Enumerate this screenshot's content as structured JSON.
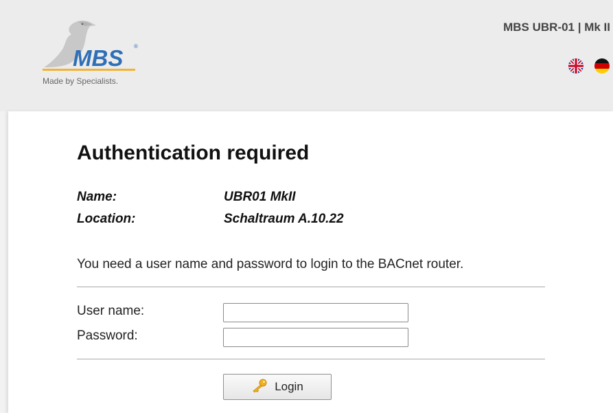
{
  "header": {
    "logo_text": "MBS",
    "logo_tagline": "Made by Specialists.",
    "device_title": "MBS UBR-01 | Mk II",
    "language_flags": [
      {
        "icon": "uk-flag-icon"
      },
      {
        "icon": "german-flag-icon"
      }
    ]
  },
  "main": {
    "title": "Authentication required",
    "info": {
      "name_label": "Name:",
      "name_value": "UBR01 MkII",
      "location_label": "Location:",
      "location_value": "Schaltraum A.10.22"
    },
    "message": "You need a user name and password to login to the BACnet router.",
    "form": {
      "username_label": "User name:",
      "username_value": "",
      "password_label": "Password:",
      "password_value": "",
      "login_label": "Login",
      "login_icon": "key-icon"
    }
  },
  "colors": {
    "logo_blue": "#2f6fb5",
    "logo_underline": "#f2b233",
    "header_bg": "#ececec"
  }
}
